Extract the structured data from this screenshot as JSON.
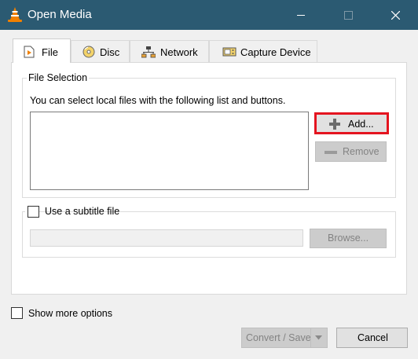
{
  "window": {
    "title": "Open Media",
    "icon": "vlc-cone-icon",
    "controls": [
      "minimize-icon",
      "maximize-icon",
      "close-icon"
    ]
  },
  "tabs": [
    {
      "label": "File",
      "icon": "file-icon",
      "active": true
    },
    {
      "label": "Disc",
      "icon": "disc-icon",
      "active": false
    },
    {
      "label": "Network",
      "icon": "network-icon",
      "active": false
    },
    {
      "label": "Capture Device",
      "icon": "capture-device-icon",
      "active": false
    }
  ],
  "file_selection": {
    "legend": "File Selection",
    "description": "You can select local files with the following list and buttons.",
    "files": [],
    "add_label": "Add...",
    "add_icon": "plus-icon",
    "remove_label": "Remove",
    "remove_icon": "minus-icon"
  },
  "subtitle": {
    "checkbox_label": "Use a subtitle file",
    "checked": false,
    "path_value": "",
    "browse_label": "Browse..."
  },
  "options": {
    "show_more_label": "Show more options",
    "checked": false
  },
  "footer": {
    "convert_label": "Convert / Save",
    "cancel_label": "Cancel"
  },
  "colors": {
    "titlebar": "#2b5a72",
    "highlight_border": "#e4141f",
    "vlc_orange": "#f08000"
  }
}
